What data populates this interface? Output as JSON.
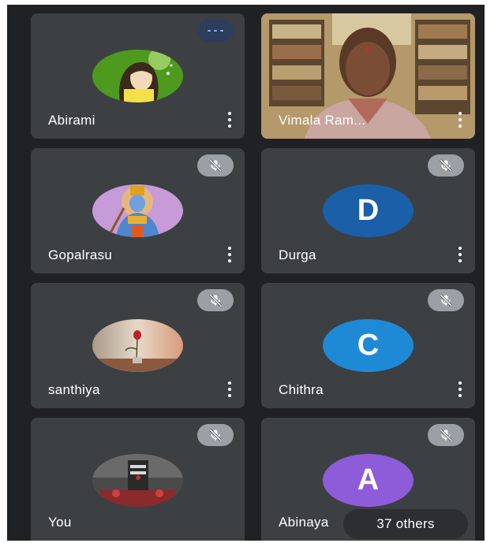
{
  "participants": [
    {
      "name": "Abirami",
      "status": "speaking",
      "avatar": "cartoon-girl-image"
    },
    {
      "name": "Vimala Ram...",
      "status": "video",
      "avatar": "camera-video"
    },
    {
      "name": "Gopalrasu",
      "status": "muted",
      "avatar": "deity-image"
    },
    {
      "name": "Durga",
      "status": "muted",
      "avatar": "letter",
      "letter": "D",
      "color": "#1a5fa8"
    },
    {
      "name": "santhiya",
      "status": "muted",
      "avatar": "rose-image"
    },
    {
      "name": "Chithra",
      "status": "muted",
      "avatar": "letter",
      "letter": "C",
      "color": "#1e8ad6"
    },
    {
      "name": "You",
      "status": "muted",
      "avatar": "temple-image"
    },
    {
      "name": "Abinaya",
      "status": "muted",
      "avatar": "letter",
      "letter": "A",
      "color": "#8e5cd9"
    }
  ],
  "overflow": {
    "label": "37 others"
  },
  "icons": {
    "mute": "mic-off-icon",
    "more": "more-vert-icon",
    "speaking": "audio-level-icon"
  },
  "colors": {
    "background": "#202124",
    "tile": "#3c4043",
    "mute_badge": "#9aa0a6"
  }
}
